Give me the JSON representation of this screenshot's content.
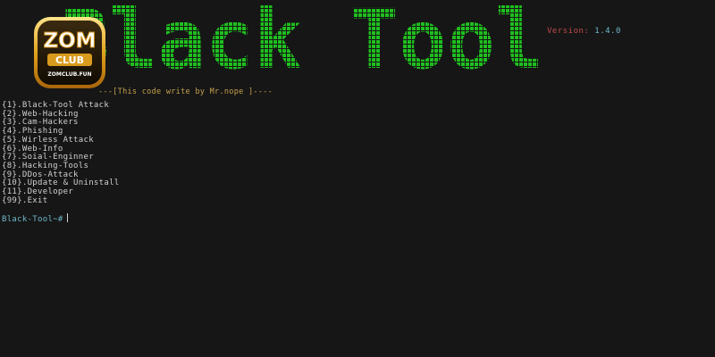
{
  "banner": {
    "title": "Black Tool",
    "color": "#1fbf1f"
  },
  "version": {
    "key": "Version:",
    "value": "1.4.0"
  },
  "credit_text": "---[This code write by Mr.nope ]----",
  "logo": {
    "line1": "ZOM",
    "line2": "CLUB",
    "line3": "ZOMCLUB.FUN"
  },
  "menu": {
    "items": [
      "{1}.Black-Tool Attack",
      "{2}.Web-Hacking",
      "{3}.Cam-Hackers",
      "{4}.Phishing",
      "{5}.Wirless Attack",
      "{6}.Web-Info",
      "{7}.Soial-Enginner",
      "{8}.Hacking-Tools",
      "{9}.DDos-Attack",
      "{10}.Update & Uninstall",
      "{11}.Developer",
      "{99}.Exit"
    ]
  },
  "prompt": "Black-Tool~#",
  "colors": {
    "background": "#161616",
    "banner_green": "#1fbf1f",
    "version_key": "#c24a4a",
    "version_value": "#6fb7c9",
    "credit": "#c6a24d",
    "prompt": "#6fb7c9"
  }
}
